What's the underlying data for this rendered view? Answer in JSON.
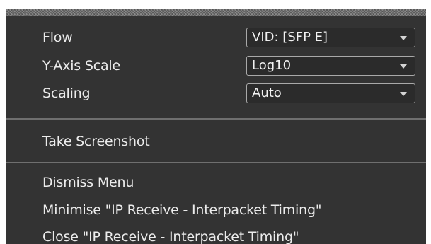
{
  "settings": [
    {
      "label": "Flow",
      "value": "VID: [SFP E]"
    },
    {
      "label": "Y-Axis Scale",
      "value": "Log10"
    },
    {
      "label": "Scaling",
      "value": "Auto"
    }
  ],
  "actions": {
    "take_screenshot": "Take Screenshot",
    "dismiss_menu": "Dismiss Menu",
    "minimise": "Minimise \"IP Receive - Interpacket Timing\"",
    "close": "Close \"IP Receive - Interpacket Timing\""
  },
  "colors": {
    "menu_background": "#333333",
    "text": "#ececec",
    "dropdown_border": "#a9a9a9",
    "divider": "#6f6f6f"
  },
  "icons": {
    "dropdown_arrow": "chevron-down-icon",
    "drag_handle": "grip-handle"
  }
}
